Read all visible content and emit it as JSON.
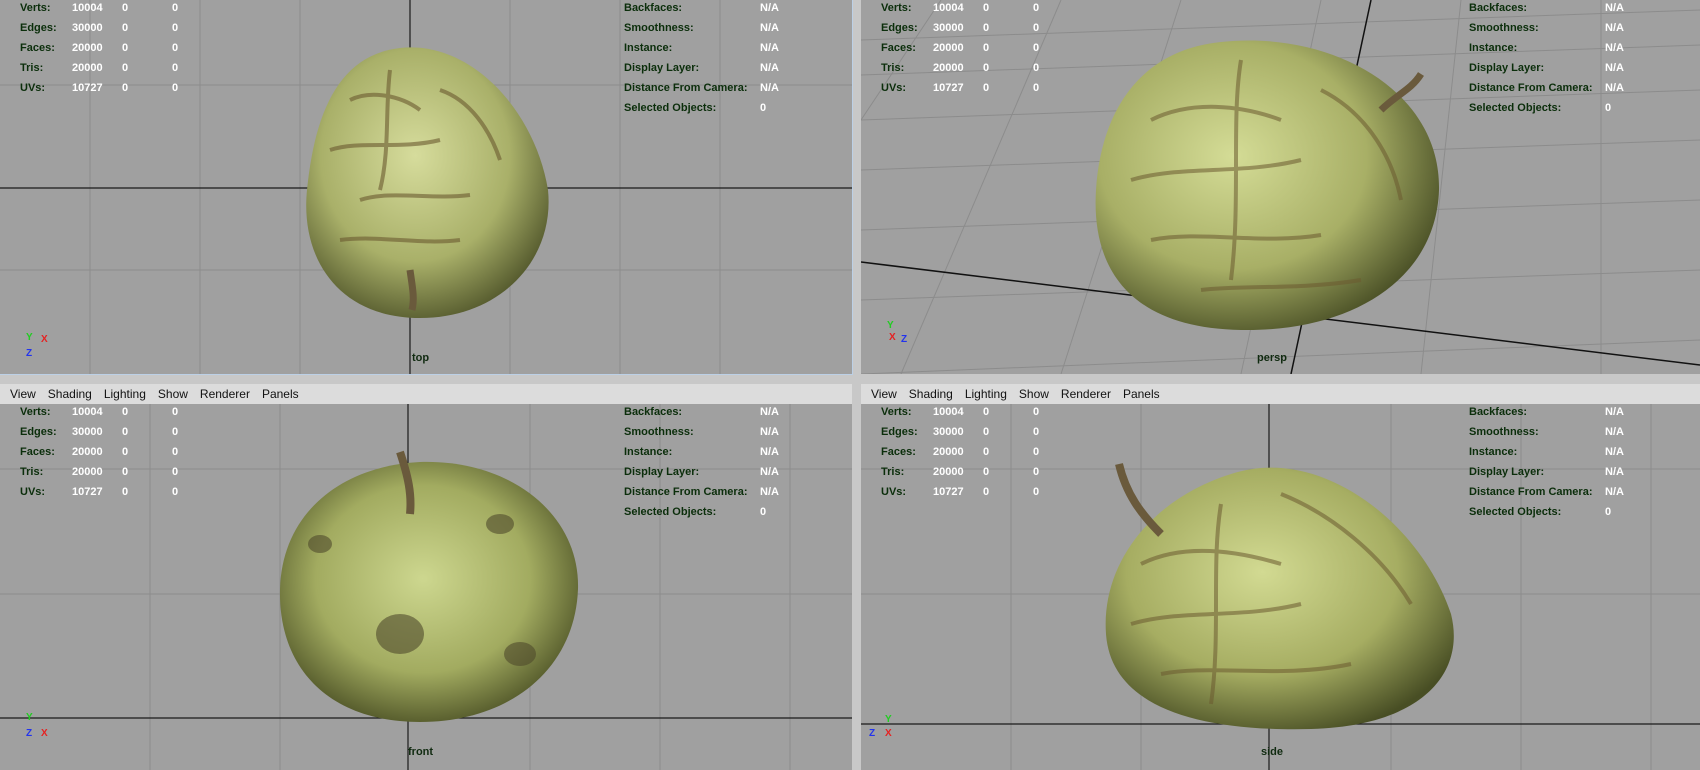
{
  "menus": [
    "View",
    "Shading",
    "Lighting",
    "Show",
    "Renderer",
    "Panels"
  ],
  "stats": {
    "rows": [
      {
        "label": "Verts:",
        "a": "10004",
        "b": "0",
        "c": "0"
      },
      {
        "label": "Edges:",
        "a": "30000",
        "b": "0",
        "c": "0"
      },
      {
        "label": "Faces:",
        "a": "20000",
        "b": "0",
        "c": "0"
      },
      {
        "label": "Tris:",
        "a": "20000",
        "b": "0",
        "c": "0"
      },
      {
        "label": "UVs:",
        "a": "10727",
        "b": "0",
        "c": "0"
      }
    ],
    "right": [
      {
        "label": "Backfaces:",
        "value": "N/A"
      },
      {
        "label": "Smoothness:",
        "value": "N/A"
      },
      {
        "label": "Instance:",
        "value": "N/A"
      },
      {
        "label": "Display Layer:",
        "value": "N/A"
      },
      {
        "label": "Distance From Camera:",
        "value": "N/A"
      },
      {
        "label": "Selected Objects:",
        "value": "0"
      }
    ]
  },
  "viewports": {
    "top": {
      "camera": "top",
      "axis1": "Y",
      "axis2": "X",
      "axis3": "Z"
    },
    "persp": {
      "camera": "persp",
      "axis1": "Y",
      "axis2": "X",
      "axis3": "Z"
    },
    "front": {
      "camera": "front",
      "axis1": "Y",
      "axis2": "X",
      "axis3": "Z"
    },
    "side": {
      "camera": "side",
      "axis1": "Y",
      "axis2": "X",
      "axis3": "Z"
    }
  },
  "colors": {
    "background": "#a0a0a0",
    "grid": "#8a8a8a",
    "axis_line": "#1a1a1a",
    "hud_text": "#0b2e0b",
    "fruit": "#b9c27a"
  }
}
